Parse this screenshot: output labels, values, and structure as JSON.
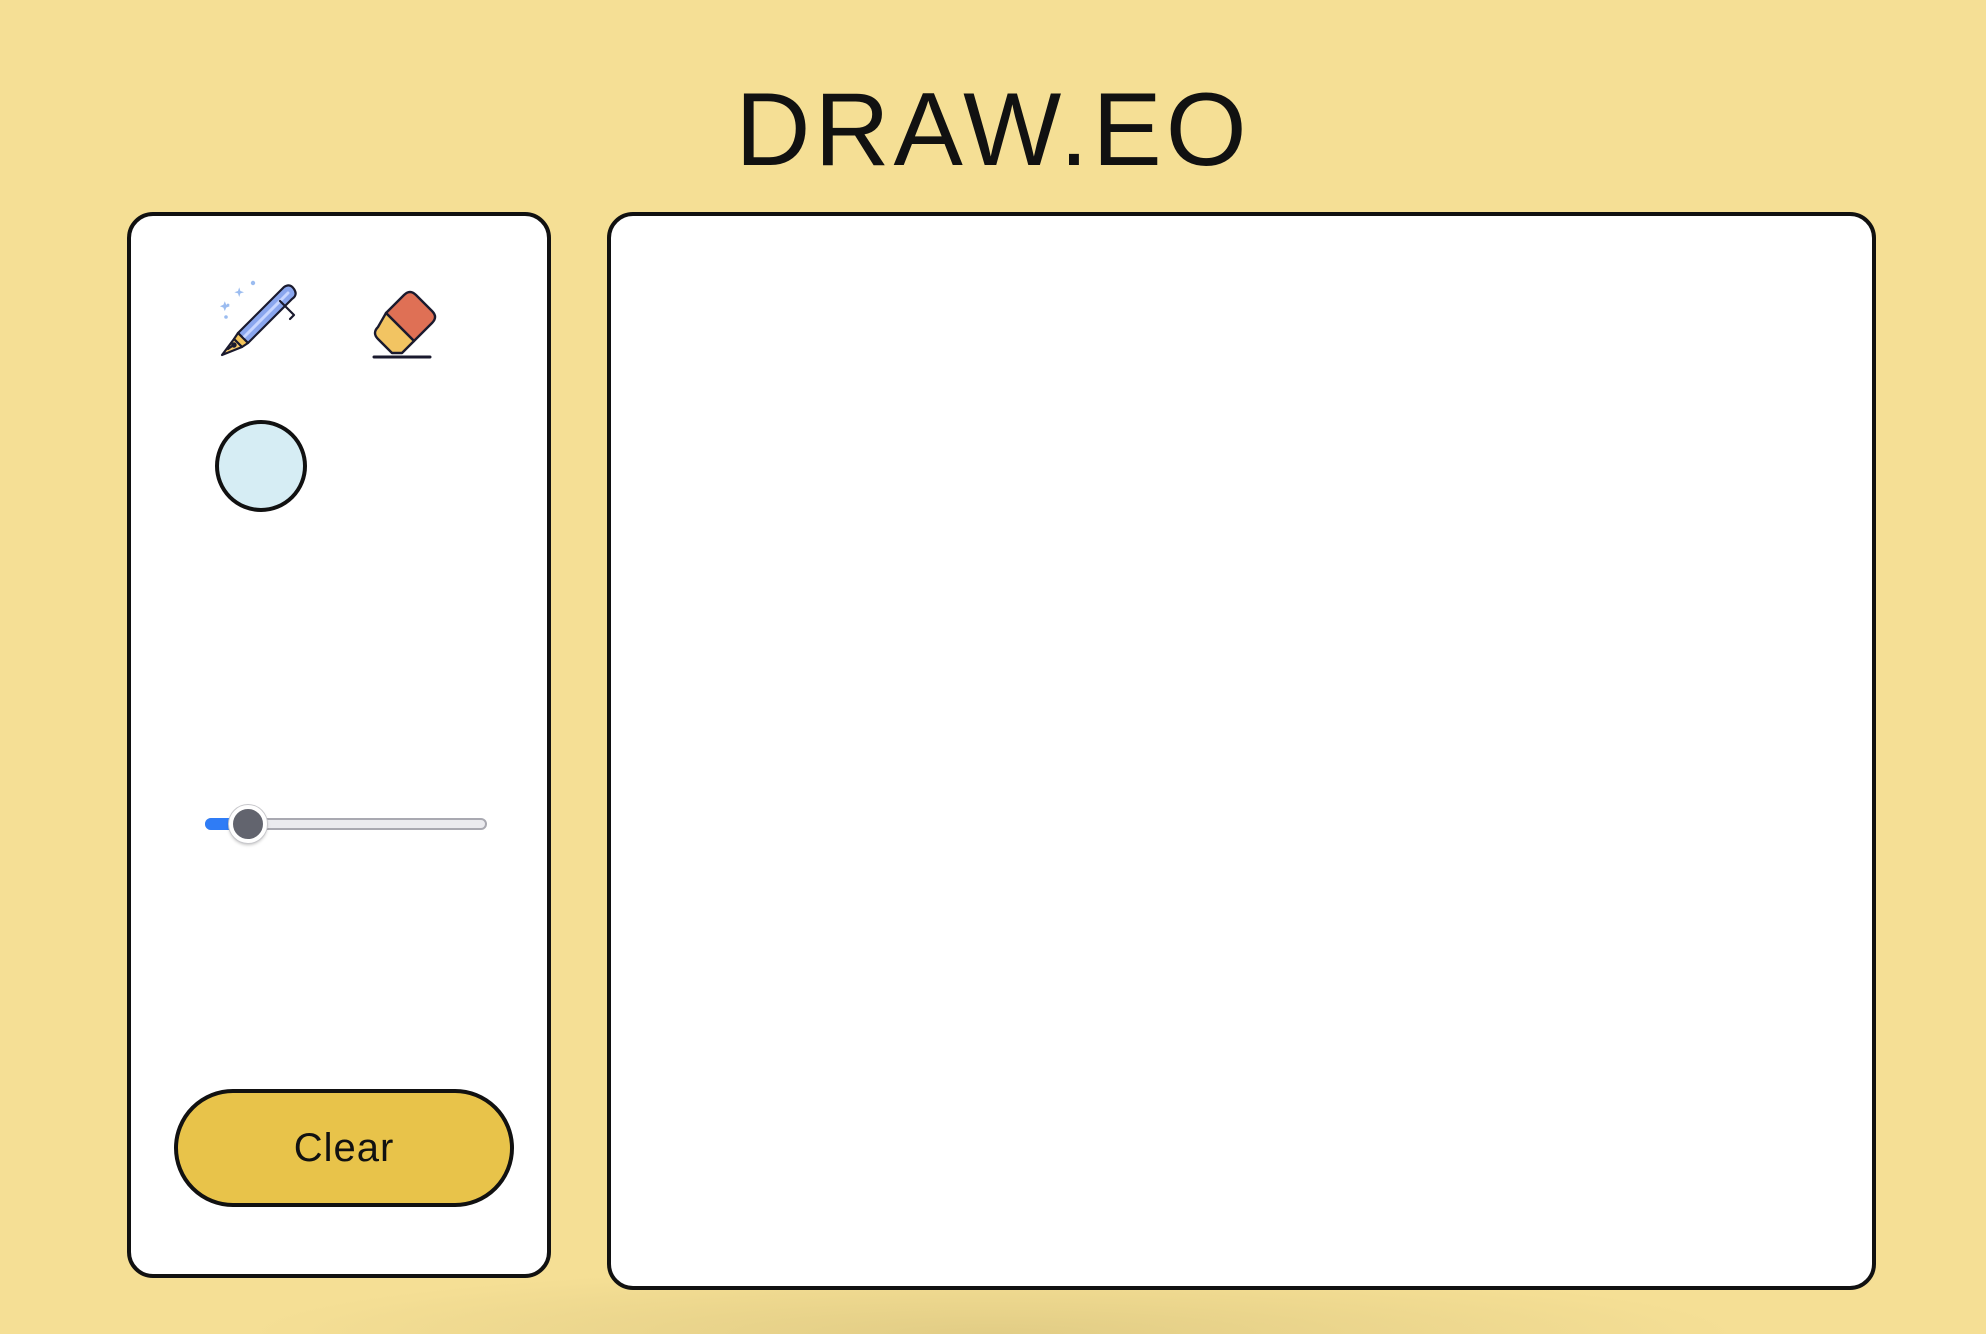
{
  "app": {
    "title": "DRAW.EO"
  },
  "toolbar": {
    "tools": [
      {
        "name": "pen",
        "icon": "fountain-pen-icon"
      },
      {
        "name": "eraser",
        "icon": "eraser-icon"
      }
    ],
    "color": {
      "value": "#d6edf4"
    },
    "brush_size": {
      "min": 0,
      "max": 100,
      "value": 10
    },
    "clear_label": "Clear"
  },
  "theme": {
    "background": "#f5df95",
    "accent": "#e8c34a",
    "slider_fill": "#2f7cf6"
  }
}
